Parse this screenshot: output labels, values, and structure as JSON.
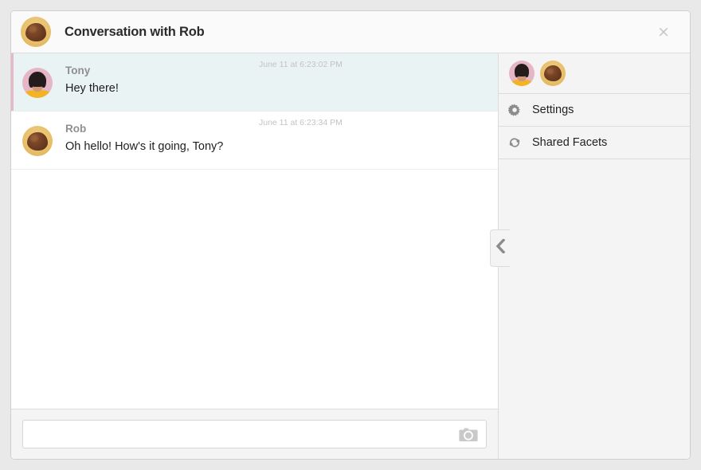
{
  "window": {
    "title": "Conversation with Rob",
    "title_avatar": "rob-avatar",
    "close_label": "×"
  },
  "messages": [
    {
      "author": "Tony",
      "text": "Hey there!",
      "timestamp": "June 11 at 6:23:02 PM",
      "avatar": "tony-avatar",
      "highlighted": true
    },
    {
      "author": "Rob",
      "text": "Oh hello! How's it going, Tony?",
      "timestamp": "June 11 at 6:23:34 PM",
      "avatar": "rob-avatar",
      "highlighted": false
    }
  ],
  "composer": {
    "value": "",
    "placeholder": "",
    "camera_icon": "camera-icon"
  },
  "side_panel": {
    "participants": [
      {
        "name": "Tony",
        "avatar": "tony-avatar"
      },
      {
        "name": "Rob",
        "avatar": "rob-avatar"
      }
    ],
    "items": [
      {
        "label": "Settings",
        "icon": "gear-icon"
      },
      {
        "label": "Shared Facets",
        "icon": "shared-facets-icon"
      }
    ]
  },
  "collapse_handle": {
    "icon": "chevron-left-icon"
  },
  "colors": {
    "window_background": "#ffffff",
    "page_background": "#e9e9e9",
    "panel_background": "#f4f4f4",
    "highlight_row": "#eaf3f3",
    "accent_stripe": "#e8b9c4",
    "border": "#dcdcdc",
    "muted_text": "#8f8f8f",
    "timestamp_text": "#c3c3c3"
  }
}
